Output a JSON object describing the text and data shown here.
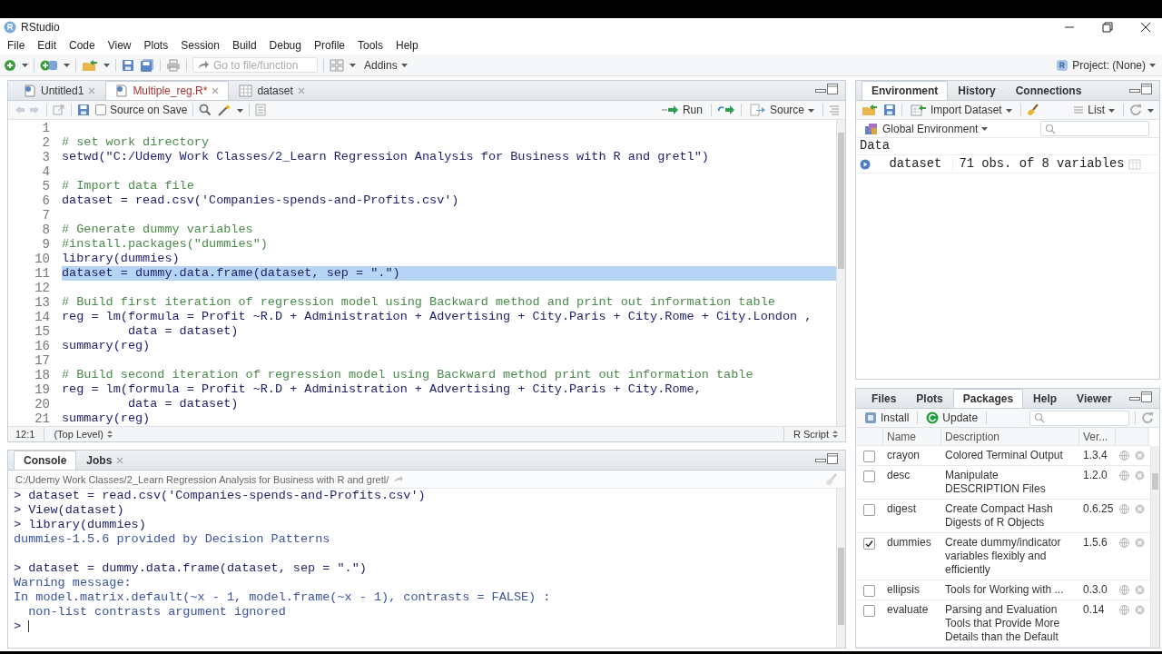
{
  "window": {
    "title": "RStudio"
  },
  "menu": [
    "File",
    "Edit",
    "Code",
    "View",
    "Plots",
    "Session",
    "Build",
    "Debug",
    "Profile",
    "Tools",
    "Help"
  ],
  "toolbar": {
    "goto_placeholder": "Go to file/function",
    "addins": "Addins",
    "project": "Project: (None)"
  },
  "editor": {
    "tabs": [
      {
        "label": "Untitled1",
        "kind": "script",
        "modified": false,
        "selected": false
      },
      {
        "label": "Multiple_reg.R*",
        "kind": "script",
        "modified": true,
        "selected": true
      },
      {
        "label": "dataset",
        "kind": "data",
        "modified": false,
        "selected": false
      }
    ],
    "source_on_save": {
      "label": "Source on Save",
      "checked": false
    },
    "run": "Run",
    "source": "Source",
    "lines": [
      {
        "number": "1",
        "kind": "code",
        "selected": false
      },
      {
        "number": "2",
        "kind": "comment",
        "text": "# set work directory",
        "selected": false
      },
      {
        "number": "3",
        "kind": "code",
        "text": "setwd(\"C:/Udemy Work Classes/2_Learn Regression Analysis for Business with R and gretl\")",
        "selected": false
      },
      {
        "number": "4",
        "kind": "code",
        "selected": false
      },
      {
        "number": "5",
        "kind": "comment",
        "text": "# Import data file",
        "selected": false
      },
      {
        "number": "6",
        "kind": "code",
        "text": "dataset = read.csv('Companies-spends-and-Profits.csv')",
        "selected": false
      },
      {
        "number": "7",
        "kind": "code",
        "selected": false
      },
      {
        "number": "8",
        "kind": "comment",
        "text": "# Generate dummy variables",
        "selected": false
      },
      {
        "number": "9",
        "kind": "comment",
        "text": "#install.packages(\"dummies\")",
        "selected": false
      },
      {
        "number": "10",
        "kind": "code",
        "text": "library(dummies)",
        "selected": false
      },
      {
        "number": "11",
        "kind": "code",
        "text": "dataset = dummy.data.frame(dataset, sep = \".\")",
        "selected": true
      },
      {
        "number": "12",
        "kind": "code",
        "selected": false
      },
      {
        "number": "13",
        "kind": "comment",
        "text": "# Build first iteration of regression model using Backward method and print out information table",
        "selected": false
      },
      {
        "number": "14",
        "kind": "code",
        "text": "reg = lm(formula = Profit ~R.D + Administration + Advertising + City.Paris + City.Rome + City.London ,",
        "selected": false
      },
      {
        "number": "15",
        "kind": "code",
        "text": "         data = dataset)",
        "selected": false
      },
      {
        "number": "16",
        "kind": "code",
        "text": "summary(reg)",
        "selected": false
      },
      {
        "number": "17",
        "kind": "code",
        "selected": false
      },
      {
        "number": "18",
        "kind": "comment",
        "text": "# Build second iteration of regression model using Backward method print out information table",
        "selected": false
      },
      {
        "number": "19",
        "kind": "code",
        "text": "reg = lm(formula = Profit ~R.D + Administration + Advertising + City.Paris + City.Rome,",
        "selected": false
      },
      {
        "number": "20",
        "kind": "code",
        "text": "         data = dataset)",
        "selected": false
      },
      {
        "number": "21",
        "kind": "code",
        "text": "summary(reg)",
        "selected": false
      }
    ],
    "status": {
      "position": "12:1",
      "scope": "(Top Level)",
      "file_type": "R Script"
    }
  },
  "console": {
    "tabs": [
      {
        "label": "Console",
        "closable": false,
        "selected": true
      },
      {
        "label": "Jobs",
        "closable": true,
        "selected": false
      }
    ],
    "path": "C:/Udemy Work Classes/2_Learn Regression Analysis for Business with R and gretl/",
    "lines": [
      {
        "kind": "input",
        "text": "> dataset = read.csv('Companies-spends-and-Profits.csv')"
      },
      {
        "kind": "input",
        "text": "> View(dataset)"
      },
      {
        "kind": "input",
        "text": "> library(dummies)"
      },
      {
        "kind": "output",
        "text": "dummies-1.5.6 provided by Decision Patterns"
      },
      {
        "kind": "blank"
      },
      {
        "kind": "input",
        "text": "> dataset = dummy.data.frame(dataset, sep = \".\")"
      },
      {
        "kind": "output",
        "text": "Warning message:"
      },
      {
        "kind": "output",
        "text": "In model.matrix.default(~x - 1, model.frame(~x - 1), contrasts = FALSE) :"
      },
      {
        "kind": "output",
        "text": "  non-list contrasts argument ignored"
      },
      {
        "kind": "prompt",
        "text": ">"
      }
    ]
  },
  "environment": {
    "tabs": [
      {
        "label": "Environment",
        "selected": true
      },
      {
        "label": "History",
        "selected": false
      },
      {
        "label": "Connections",
        "selected": false
      }
    ],
    "import": "Import Dataset",
    "view": "List",
    "scope": "Global Environment",
    "section": "Data",
    "objects": [
      {
        "name": "dataset",
        "summary": "71 obs. of 8 variables"
      }
    ]
  },
  "packages": {
    "tabs": [
      {
        "label": "Files",
        "selected": false
      },
      {
        "label": "Plots",
        "selected": false
      },
      {
        "label": "Packages",
        "selected": true
      },
      {
        "label": "Help",
        "selected": false
      },
      {
        "label": "Viewer",
        "selected": false
      }
    ],
    "install": "Install",
    "update": "Update",
    "columns": [
      "Name",
      "Description",
      "Ver..."
    ],
    "rows": [
      {
        "name": "crayon",
        "description": "Colored Terminal Output",
        "version": "1.3.4",
        "checked": false
      },
      {
        "name": "desc",
        "description": "Manipulate DESCRIPTION Files",
        "version": "1.2.0",
        "checked": false
      },
      {
        "name": "digest",
        "description": "Create Compact Hash Digests of R Objects",
        "version": "0.6.25",
        "checked": false
      },
      {
        "name": "dummies",
        "description": "Create dummy/indicator variables flexibly and efficiently",
        "version": "1.5.6",
        "checked": true
      },
      {
        "name": "ellipsis",
        "description": "Tools for Working with ...",
        "version": "0.3.0",
        "checked": false
      },
      {
        "name": "evaluate",
        "description": "Parsing and Evaluation Tools that Provide More Details than the Default",
        "version": "0.14",
        "checked": false
      }
    ]
  }
}
